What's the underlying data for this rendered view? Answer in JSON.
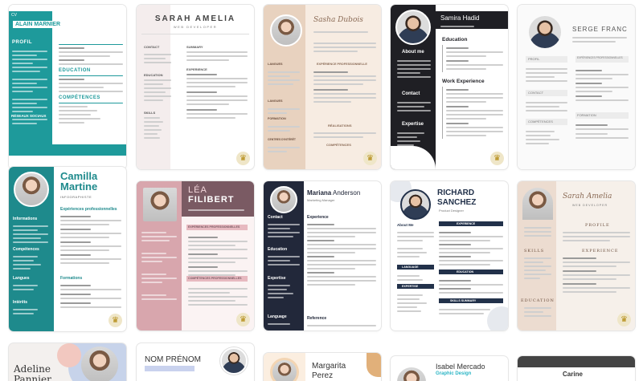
{
  "crown_icon": "crown-icon",
  "cards": {
    "c1": {
      "label": "CV",
      "name": "ALAIN MARNIER",
      "sections": [
        "PROFIL",
        "EDUCATION",
        "COMPÉTENCES",
        "RÉSEAUX SOCIAUX"
      ],
      "colors": {
        "accent": "#1e9a9b"
      }
    },
    "c2": {
      "name": "SARAH AMELIA",
      "subtitle": "WEB DEVELOPER",
      "sections": [
        "CONTACT",
        "SUMMARY",
        "EDUCATION",
        "EXPERIENCE",
        "SKILLS"
      ]
    },
    "c3": {
      "name": "Sasha Dubois",
      "sections": [
        "EXPÉRIENCE PROFESSIONNELLE",
        "LANGUES",
        "FORMATION",
        "RÉALISATIONS",
        "CENTRES D'INTÉRÊT",
        "COMPÉTENCES"
      ]
    },
    "c4": {
      "name": "Samira Hadid",
      "sections": [
        "About me",
        "Education",
        "Contact",
        "Work Experience",
        "Expertise"
      ]
    },
    "c5": {
      "name": "SERGE FRANC",
      "sections": [
        "PROFIL",
        "EXPÉRIENCES PROFESSIONNELLES",
        "CONTACT",
        "COMPÉTENCES",
        "FORMATION"
      ]
    },
    "c6": {
      "first": "Camilla",
      "last": "Martine",
      "role": "INFOGRAPHISTE",
      "sections": [
        "Expériences professionnelles",
        "Informations",
        "Compétences",
        "Formations",
        "Langues",
        "Intérêts"
      ]
    },
    "c7": {
      "first": "LÉA",
      "last": "FILIBERT",
      "sections": [
        "EXPÉRIENCES PROFESSIONNELLES",
        "COMPÉTENCES PROFESSIONNELLES"
      ]
    },
    "c8": {
      "first": "Mariana",
      "last": "Anderson",
      "role": "Marketing Manager",
      "sections": [
        "Contact",
        "Experience",
        "Education",
        "Expertise",
        "Language",
        "Reference"
      ]
    },
    "c9": {
      "first": "RICHARD",
      "last": "SANCHEZ",
      "role": "Product Designer",
      "sections": [
        "About Me",
        "EXPERIENCE",
        "LANGUAGE",
        "EDUCATION",
        "EXPERTISE",
        "SKILLS SUMMARY"
      ]
    },
    "c10": {
      "name": "Sarah Amelia",
      "subtitle": "WEB DEVELOPER",
      "sections": [
        "PROFILE",
        "SKILLS",
        "EXPERIENCE",
        "EDUCATION"
      ]
    },
    "c11": {
      "first": "Adeline",
      "last": "Pannier"
    },
    "c12": {
      "name": "NOM PRÉNOM"
    },
    "c13": {
      "first": "Margarita",
      "last": "Perez"
    },
    "c14": {
      "name": "Isabel Mercado",
      "role": "Graphic Design"
    },
    "c15": {
      "name": "Carine"
    }
  }
}
